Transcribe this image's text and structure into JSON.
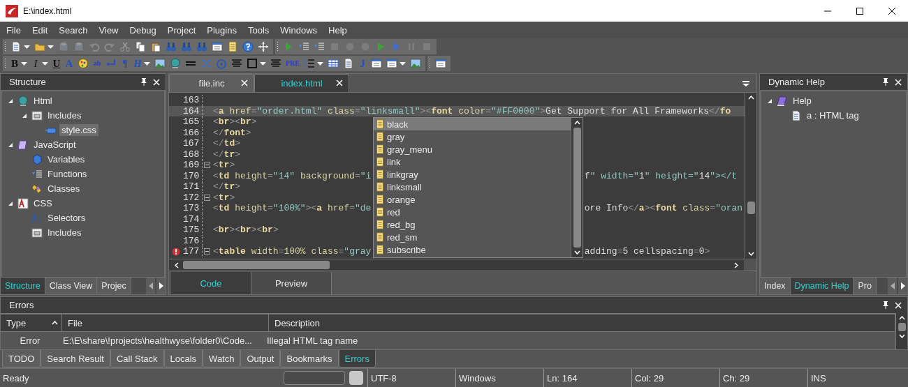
{
  "window": {
    "title": "E:\\index.html"
  },
  "menu": [
    "File",
    "Edit",
    "Search",
    "View",
    "Debug",
    "Project",
    "Plugins",
    "Tools",
    "Windows",
    "Help"
  ],
  "toolbars": [
    {
      "groups": [
        {
          "buttons": [
            {
              "disabled": false,
              "dropdown": true
            },
            {
              "disabled": false,
              "dropdown": true
            },
            {
              "disabled": true,
              "dropdown": false
            },
            {
              "disabled": true,
              "dropdown": false
            },
            {
              "disabled": true,
              "dropdown": false
            },
            {
              "disabled": true,
              "dropdown": false
            },
            {
              "disabled": true,
              "dropdown": false
            },
            {
              "disabled": false,
              "dropdown": false
            },
            {
              "disabled": false,
              "dropdown": false
            },
            {
              "disabled": false,
              "dropdown": false
            },
            {
              "disabled": false,
              "dropdown": false
            },
            {
              "disabled": false,
              "dropdown": false
            },
            {
              "disabled": false,
              "dropdown": false
            },
            {
              "disabled": false,
              "dropdown": false
            },
            {
              "disabled": false,
              "dropdown": false
            },
            {
              "disabled": false,
              "dropdown": false
            }
          ]
        },
        {
          "buttons": [
            {
              "disabled": false,
              "dropdown": false
            },
            {
              "disabled": false,
              "dropdown": false
            },
            {
              "disabled": false,
              "dropdown": false
            },
            {
              "disabled": true,
              "dropdown": false
            },
            {
              "disabled": true,
              "dropdown": false
            },
            {
              "disabled": true,
              "dropdown": false
            },
            {
              "disabled": false,
              "dropdown": false
            },
            {
              "disabled": false,
              "dropdown": false
            },
            {
              "disabled": true,
              "dropdown": false
            },
            {
              "disabled": true,
              "dropdown": false
            }
          ]
        }
      ]
    },
    {
      "groups": [
        {
          "buttons": [
            {
              "glyph": "B",
              "disabled": false,
              "dropdown": true
            },
            {
              "glyph": "I",
              "disabled": false,
              "dropdown": true
            },
            {
              "glyph": "U",
              "disabled": false,
              "dropdown": false
            },
            {
              "glyph": "A",
              "disabled": false,
              "dropdown": false
            },
            {
              "disabled": false,
              "dropdown": false
            },
            {
              "glyph": "ab",
              "disabled": false,
              "dropdown": false
            },
            {
              "disabled": false,
              "dropdown": false
            },
            {
              "glyph": "¶",
              "disabled": false,
              "dropdown": false
            },
            {
              "glyph": "H",
              "disabled": false,
              "dropdown": true
            },
            {
              "disabled": false,
              "dropdown": false
            },
            {
              "disabled": false,
              "dropdown": false
            },
            {
              "disabled": false,
              "dropdown": false
            },
            {
              "disabled": false,
              "dropdown": false
            },
            {
              "disabled": false,
              "dropdown": false
            },
            {
              "disabled": false,
              "dropdown": false
            },
            {
              "disabled": false,
              "dropdown": true
            },
            {
              "disabled": false,
              "dropdown": false
            },
            {
              "glyph": "PRE",
              "disabled": false,
              "dropdown": false
            },
            {
              "disabled": false,
              "dropdown": true
            },
            {
              "disabled": false,
              "dropdown": false
            },
            {
              "disabled": false,
              "dropdown": false
            },
            {
              "glyph": "J",
              "disabled": false,
              "dropdown": false
            },
            {
              "disabled": false,
              "dropdown": false
            },
            {
              "disabled": false,
              "dropdown": true
            },
            {
              "disabled": false,
              "dropdown": false
            }
          ]
        },
        {
          "buttons": [
            {
              "disabled": false,
              "dropdown": false
            }
          ]
        }
      ]
    }
  ],
  "structure": {
    "title": "Structure",
    "tree": [
      {
        "label": "Html",
        "expanded": true,
        "selected": false,
        "children": [
          {
            "label": "Includes",
            "expanded": true,
            "selected": false,
            "children": [
              {
                "label": "style.css",
                "selected": true
              }
            ]
          }
        ]
      },
      {
        "label": "JavaScript",
        "expanded": true,
        "selected": false,
        "children": [
          {
            "label": "Variables",
            "selected": false
          },
          {
            "label": "Functions",
            "selected": false
          },
          {
            "label": "Classes",
            "selected": false
          }
        ]
      },
      {
        "label": "CSS",
        "expanded": true,
        "selected": false,
        "children": [
          {
            "label": "Selectors",
            "selected": false
          },
          {
            "label": "Includes",
            "selected": false
          }
        ]
      }
    ],
    "tabs": [
      {
        "label": "Structure",
        "selected": true
      },
      {
        "label": "Class View",
        "selected": false
      },
      {
        "label": "Projec",
        "selected": false
      }
    ]
  },
  "editor": {
    "tabs": [
      {
        "label": "file.inc",
        "selected": false
      },
      {
        "label": "index.html",
        "selected": true
      }
    ],
    "lines": [
      {
        "number": "163",
        "current": false,
        "fold": false,
        "error": false
      },
      {
        "number": "164",
        "text": "<a href=\"order.html\" class=\"linksmall\"><font color=\"#FF0000\">Get Support for All Frameworks</fo",
        "current": true,
        "fold": false,
        "error": false
      },
      {
        "number": "165",
        "text": "<br><br>",
        "current": false,
        "fold": false,
        "error": false
      },
      {
        "number": "166",
        "text": "</font>",
        "current": false,
        "fold": false,
        "error": false
      },
      {
        "number": "167",
        "text": "</td>",
        "current": false,
        "fold": false,
        "error": false
      },
      {
        "number": "168",
        "text": "</tr>",
        "current": false,
        "fold": false,
        "error": false
      },
      {
        "number": "169",
        "text": "<tr>",
        "current": false,
        "fold": true,
        "error": false
      },
      {
        "number": "170",
        "text": "<td height=\"14\" background=\"i",
        "tail": "f\" width=\"1\" height=\"14\"></t",
        "current": false,
        "fold": false,
        "error": false
      },
      {
        "number": "171",
        "text": "</tr>",
        "current": false,
        "fold": false,
        "error": false
      },
      {
        "number": "172",
        "text": "<tr>",
        "current": false,
        "fold": true,
        "error": false
      },
      {
        "number": "173",
        "text": "<td height=\"100%\"><a href=\"de",
        "tail": "ore Info</a><font class=\"oran",
        "current": false,
        "fold": false,
        "error": false
      },
      {
        "number": "174",
        "current": false,
        "fold": false,
        "error": false
      },
      {
        "number": "175",
        "text": "<br><br><br>",
        "current": false,
        "fold": false,
        "error": false
      },
      {
        "number": "176",
        "current": false,
        "fold": false,
        "error": false
      },
      {
        "number": "177",
        "text": "<table width=100% class=\"gray",
        "tail": "adding=5 cellspacing=0>",
        "current": false,
        "fold": true,
        "error": true
      }
    ],
    "completion": [
      {
        "label": "black",
        "selected": true
      },
      {
        "label": "gray",
        "selected": false
      },
      {
        "label": "gray_menu",
        "selected": false
      },
      {
        "label": "link",
        "selected": false
      },
      {
        "label": "linkgray",
        "selected": false
      },
      {
        "label": "linksmall",
        "selected": false
      },
      {
        "label": "orange",
        "selected": false
      },
      {
        "label": "red",
        "selected": false
      },
      {
        "label": "red_bg",
        "selected": false
      },
      {
        "label": "red_sm",
        "selected": false
      },
      {
        "label": "subscribe",
        "selected": false
      }
    ],
    "views": [
      {
        "label": "Code",
        "selected": true
      },
      {
        "label": "Preview",
        "selected": false
      }
    ]
  },
  "dynamic_help": {
    "title": "Dynamic Help",
    "tree": [
      {
        "label": "Help",
        "expanded": true,
        "selected": false,
        "children": [
          {
            "label": "a : HTML tag",
            "selected": false
          }
        ]
      }
    ],
    "tabs": [
      {
        "label": "Index",
        "selected": false
      },
      {
        "label": "Dynamic Help",
        "selected": true
      },
      {
        "label": "Pro",
        "selected": false
      }
    ]
  },
  "errors": {
    "title": "Errors",
    "columns": [
      {
        "label": "Type",
        "sorted": true
      },
      {
        "label": "File"
      },
      {
        "label": "Description"
      }
    ],
    "rows": [
      [
        "Error",
        "E:\\E\\share\\!projects\\healthwyse\\folder0\\Code...",
        "Illegal HTML tag name"
      ]
    ]
  },
  "bottom_tabs": [
    {
      "label": "TODO",
      "selected": false
    },
    {
      "label": "Search Result",
      "selected": false
    },
    {
      "label": "Call Stack",
      "selected": false
    },
    {
      "label": "Locals",
      "selected": false
    },
    {
      "label": "Watch",
      "selected": false
    },
    {
      "label": "Output",
      "selected": false
    },
    {
      "label": "Bookmarks",
      "selected": false
    },
    {
      "label": "Errors",
      "selected": true
    }
  ],
  "status_bar": {
    "message": "Ready",
    "encoding": "UTF-8",
    "line_endings": "Windows",
    "line": "Ln: 164",
    "column": "Col: 29",
    "char": "Ch: 29",
    "mode": "INS"
  }
}
